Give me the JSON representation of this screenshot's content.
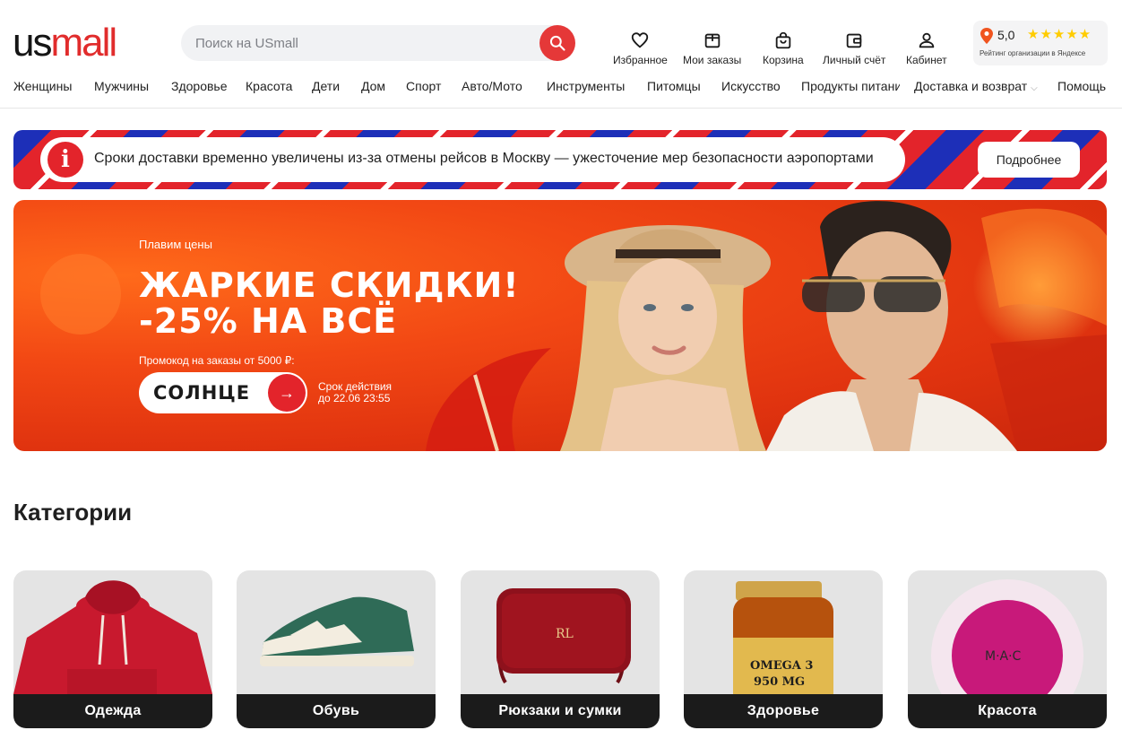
{
  "header": {
    "logo_left": "us",
    "logo_right": "mall",
    "search_placeholder": "Поиск на USmall",
    "icons": [
      {
        "label": "Избранное",
        "icon": "heart-icon"
      },
      {
        "label": "Мои заказы",
        "icon": "orders-icon"
      },
      {
        "label": "Корзина",
        "icon": "bag-icon"
      },
      {
        "label": "Личный счёт",
        "icon": "wallet-icon"
      },
      {
        "label": "Кабинет",
        "icon": "user-icon"
      }
    ],
    "rating": {
      "score": "5,0",
      "stars": "★★★★★",
      "caption": "Рейтинг организации в Яндексе"
    }
  },
  "nav": {
    "items": [
      "Женщины",
      "Мужчины",
      "Здоровье",
      "Красота",
      "Дети",
      "Дом",
      "Спорт",
      "Авто/Мото",
      "Инструменты",
      "Питомцы",
      "Искусство",
      "Продукты питания",
      "Доставка и возврат",
      "Помощь"
    ]
  },
  "notice": {
    "message": "Сроки доставки временно увеличены из-за отмены рейсов в Москву — ужесточение мер безопасности аэропортами",
    "button": "Подробнее"
  },
  "promo": {
    "kicker": "Плавим цены",
    "headline_1": "ЖАРКИЕ СКИДКИ!",
    "headline_2": "-25% НА ВСЁ",
    "note": "Промокод на заказы от 5000 ₽:",
    "code": "СОЛНЦЕ",
    "valid_1": "Срок действия",
    "valid_2": "до 22.06 23:55"
  },
  "categories": {
    "title": "Категории",
    "items": [
      {
        "label": "Одежда"
      },
      {
        "label": "Обувь"
      },
      {
        "label": "Рюкзаки и сумки"
      },
      {
        "label": "Здоровье"
      },
      {
        "label": "Красота"
      }
    ]
  },
  "colors": {
    "brand": "#e12c2c",
    "accent": "#e53838",
    "star": "#ffcc00"
  }
}
